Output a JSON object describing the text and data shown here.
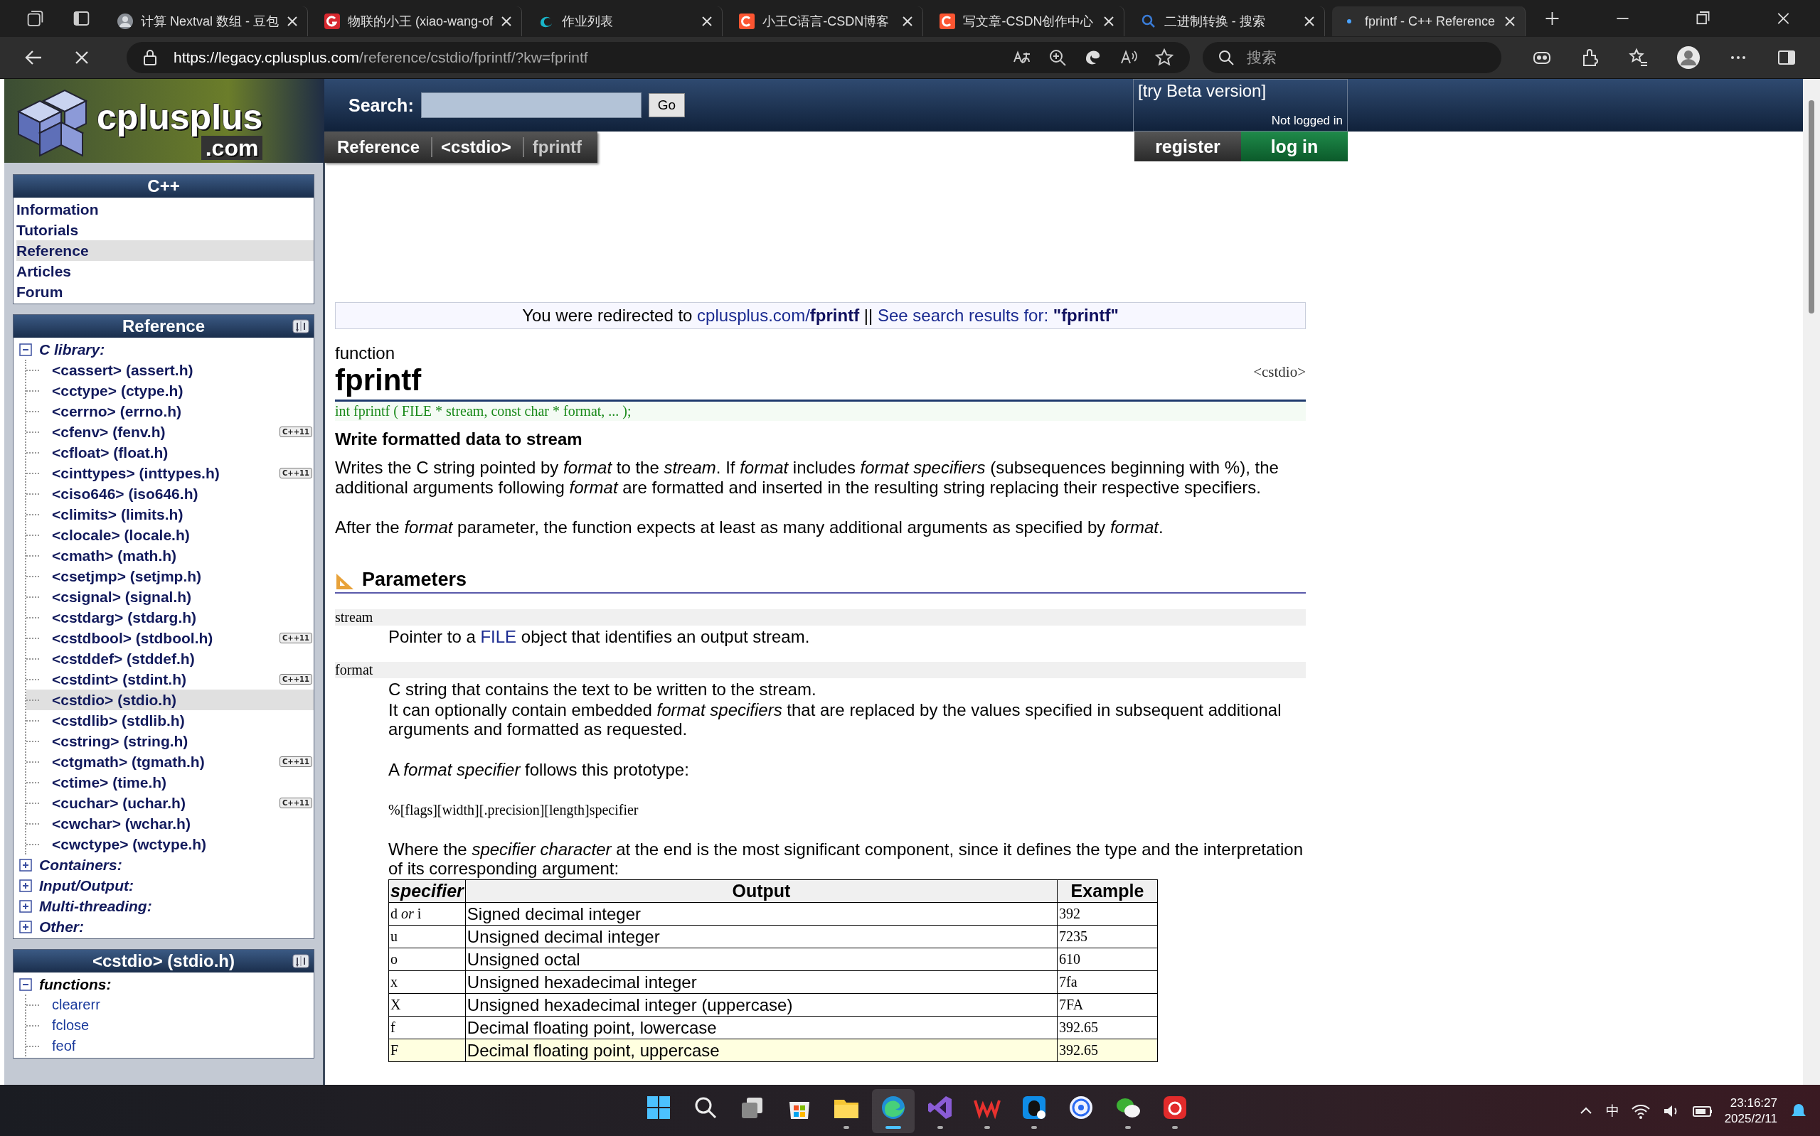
{
  "browser": {
    "tabs": [
      {
        "title": "计算 Nextval 数组 - 豆包",
        "selected": false
      },
      {
        "title": "物联的小王 (xiao-wang-of",
        "selected": false
      },
      {
        "title": "作业列表",
        "selected": false
      },
      {
        "title": "小王C语言-CSDN博客",
        "selected": false
      },
      {
        "title": "写文章-CSDN创作中心",
        "selected": false
      },
      {
        "title": "二进制转换 - 搜索",
        "selected": false
      },
      {
        "title": "fprintf - C++ Reference",
        "selected": true
      }
    ],
    "url_host": "https://legacy.cplusplus.com",
    "url_path": "/reference/cstdio/fprintf/?kw=fprintf",
    "search_placeholder": "搜索"
  },
  "site": {
    "logo": "cplusplus",
    "logo_suffix": ".com",
    "search_label": "Search:",
    "go": "Go",
    "beta": "[try Beta version]",
    "login_status": "Not logged in",
    "breadcrumb": [
      "Reference",
      "<cstdio>",
      "fprintf"
    ],
    "register": "register",
    "login": "log in"
  },
  "sidebar": [
    {
      "title": "C++",
      "sortable": false,
      "items": [
        {
          "label": "Information",
          "selected": false
        },
        {
          "label": "Tutorials",
          "selected": false
        },
        {
          "label": "Reference",
          "selected": true
        },
        {
          "label": "Articles",
          "selected": false
        },
        {
          "label": "Forum",
          "selected": false
        }
      ]
    },
    {
      "title": "Reference",
      "sortable": true,
      "tree": [
        {
          "label": "C library:",
          "expanded": true,
          "children": [
            {
              "label": "<cassert> (assert.h)",
              "selected": false
            },
            {
              "label": "<cctype> (ctype.h)",
              "selected": false
            },
            {
              "label": "<cerrno> (errno.h)",
              "selected": false
            },
            {
              "label": "<cfenv> (fenv.h)",
              "selected": false,
              "badge": "C++11"
            },
            {
              "label": "<cfloat> (float.h)",
              "selected": false
            },
            {
              "label": "<cinttypes> (inttypes.h)",
              "selected": false,
              "badge": "C++11"
            },
            {
              "label": "<ciso646> (iso646.h)",
              "selected": false
            },
            {
              "label": "<climits> (limits.h)",
              "selected": false
            },
            {
              "label": "<clocale> (locale.h)",
              "selected": false
            },
            {
              "label": "<cmath> (math.h)",
              "selected": false
            },
            {
              "label": "<csetjmp> (setjmp.h)",
              "selected": false
            },
            {
              "label": "<csignal> (signal.h)",
              "selected": false
            },
            {
              "label": "<cstdarg> (stdarg.h)",
              "selected": false
            },
            {
              "label": "<cstdbool> (stdbool.h)",
              "selected": false,
              "badge": "C++11"
            },
            {
              "label": "<cstddef> (stddef.h)",
              "selected": false
            },
            {
              "label": "<cstdint> (stdint.h)",
              "selected": false,
              "badge": "C++11"
            },
            {
              "label": "<cstdio> (stdio.h)",
              "selected": true
            },
            {
              "label": "<cstdlib> (stdlib.h)",
              "selected": false
            },
            {
              "label": "<cstring> (string.h)",
              "selected": false
            },
            {
              "label": "<ctgmath> (tgmath.h)",
              "selected": false,
              "badge": "C++11"
            },
            {
              "label": "<ctime> (time.h)",
              "selected": false
            },
            {
              "label": "<cuchar> (uchar.h)",
              "selected": false,
              "badge": "C++11"
            },
            {
              "label": "<cwchar> (wchar.h)",
              "selected": false
            },
            {
              "label": "<cwctype> (wctype.h)",
              "selected": false
            }
          ]
        },
        {
          "label": "Containers:",
          "expanded": false
        },
        {
          "label": "Input/Output:",
          "expanded": false
        },
        {
          "label": "Multi-threading:",
          "expanded": false
        },
        {
          "label": "Other:",
          "expanded": false
        }
      ]
    },
    {
      "title": "<cstdio> (stdio.h)",
      "sortable": true,
      "tree": [
        {
          "label": "functions:",
          "expanded": true,
          "plain": true,
          "children": [
            {
              "label": "clearerr",
              "selected": false
            },
            {
              "label": "fclose",
              "selected": false
            },
            {
              "label": "feof",
              "selected": false
            }
          ]
        }
      ]
    }
  ],
  "content": {
    "redirect": {
      "text": "You were redirected to ",
      "link_prefix": "cplusplus.com/",
      "link_bold": "fprintf",
      "separator": " || ",
      "search_link": "See search results for: ",
      "query": "\"fprintf\""
    },
    "kind": "function",
    "title": "fprintf",
    "header": "<cstdio>",
    "signature": "int fprintf ( FILE * stream, const char * format, ... );",
    "summary": "Write formatted data to stream",
    "paragraphs": [
      "Writes the C string pointed by *format* to the *stream*. If *format* includes *format specifiers* (subsequences beginning with %), the additional arguments following *format* are formatted and inserted in the resulting string replacing their respective specifiers.",
      "After the *format* parameter, the function expects at least as many additional arguments as specified by *format*."
    ],
    "section": "Parameters",
    "params": [
      {
        "name": "stream",
        "blocks": [
          {
            "kind": "link_text",
            "parts": [
              "Pointer to a ",
              "FILE",
              " object that identifies an output stream."
            ]
          }
        ]
      },
      {
        "name": "format",
        "blocks": [
          {
            "kind": "text",
            "text": "C string that contains the text to be written to the stream."
          },
          {
            "kind": "text",
            "text": "It can optionally contain embedded *format specifiers* that are replaced by the values specified in subsequent additional arguments and formatted as requested."
          },
          {
            "kind": "gap"
          },
          {
            "kind": "text",
            "text": "A *format specifier* follows this prototype:"
          },
          {
            "kind": "code",
            "text": "%[flags][width][.precision][length]specifier"
          },
          {
            "kind": "text",
            "text": "Where the *specifier character* at the end is the most significant component, since it defines the type and the interpretation of its corresponding argument:"
          },
          {
            "kind": "table",
            "columns": [
              "specifier",
              "Output",
              "Example"
            ],
            "rows": [
              {
                "cells": [
                  "d *or* i",
                  "Signed decimal integer",
                  "392"
                ],
                "highlighted": false
              },
              {
                "cells": [
                  "u",
                  "Unsigned decimal integer",
                  "7235"
                ],
                "highlighted": false
              },
              {
                "cells": [
                  "o",
                  "Unsigned octal",
                  "610"
                ],
                "highlighted": false
              },
              {
                "cells": [
                  "x",
                  "Unsigned hexadecimal integer",
                  "7fa"
                ],
                "highlighted": false
              },
              {
                "cells": [
                  "X",
                  "Unsigned hexadecimal integer (uppercase)",
                  "7FA"
                ],
                "highlighted": false
              },
              {
                "cells": [
                  "f",
                  "Decimal floating point, lowercase",
                  "392.65"
                ],
                "highlighted": false
              },
              {
                "cells": [
                  "F",
                  "Decimal floating point, uppercase",
                  "392.65"
                ],
                "highlighted": true
              }
            ]
          }
        ]
      }
    ]
  },
  "taskbar": {
    "apps": [
      {
        "kind": "start",
        "running": false,
        "active": false
      },
      {
        "kind": "search",
        "running": false,
        "active": false
      },
      {
        "kind": "taskview",
        "running": false,
        "active": false
      },
      {
        "kind": "store",
        "running": false,
        "active": false
      },
      {
        "kind": "files",
        "running": true,
        "active": false
      },
      {
        "kind": "browser",
        "running": true,
        "active": true
      },
      {
        "kind": "ide",
        "running": true,
        "active": false
      },
      {
        "kind": "office",
        "running": true,
        "active": false
      },
      {
        "kind": "chat",
        "running": true,
        "active": false
      },
      {
        "kind": "compass",
        "running": false,
        "active": false
      },
      {
        "kind": "messenger",
        "running": true,
        "active": false
      },
      {
        "kind": "music",
        "running": true,
        "active": false
      }
    ],
    "ime": "中",
    "time": "23:16:27",
    "date": "2025/2/11"
  }
}
